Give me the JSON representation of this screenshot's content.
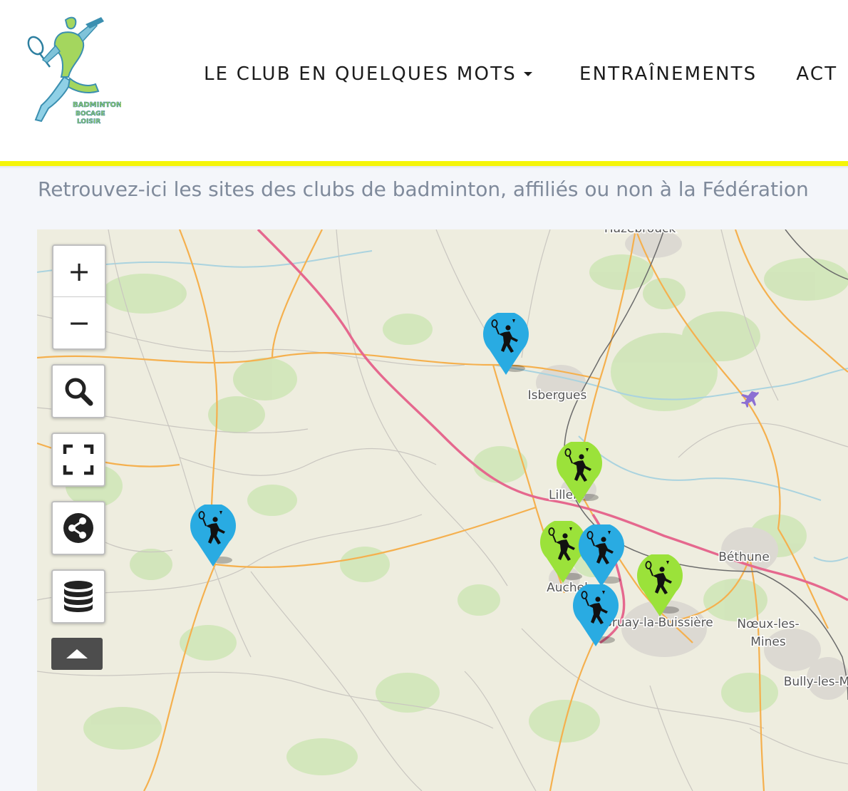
{
  "header": {
    "logo_icon": "badminton-player-logo",
    "nav": [
      {
        "label": "LE CLUB EN QUELQUES MOTS",
        "has_dropdown": true
      },
      {
        "label": "ENTRAÎNEMENTS",
        "has_dropdown": false
      },
      {
        "label": "ACT",
        "has_dropdown": false
      }
    ],
    "accent_color": "#f5f50a"
  },
  "intro_text": "Retrouvez-ici les sites des clubs de badminton, affiliés ou non à la Fédération",
  "map": {
    "controls": {
      "zoom_in": "+",
      "zoom_out": "−",
      "search_icon": "search-icon",
      "fullscreen_icon": "fullscreen-icon",
      "share_icon": "share-icon",
      "layers_icon": "database-icon",
      "collapse_icon": "triangle-up-icon"
    },
    "place_labels": [
      "Hazebrouck",
      "Isbergues",
      "Lillers",
      "Béthune",
      "Auchel",
      "Bruay-la-Buissière",
      "Nœux-les-",
      "Mines",
      "Bully-les-M"
    ],
    "marker_colors": {
      "blue": "#29abe2",
      "green": "#9be23a"
    },
    "markers": [
      {
        "color": "blue",
        "icon": "badminton-player-icon"
      },
      {
        "color": "green",
        "icon": "badminton-player-icon"
      },
      {
        "color": "blue",
        "icon": "badminton-player-icon"
      },
      {
        "color": "green",
        "icon": "badminton-player-icon"
      },
      {
        "color": "blue",
        "icon": "badminton-player-icon"
      },
      {
        "color": "green",
        "icon": "badminton-player-icon"
      },
      {
        "color": "blue",
        "icon": "badminton-player-icon"
      }
    ]
  }
}
